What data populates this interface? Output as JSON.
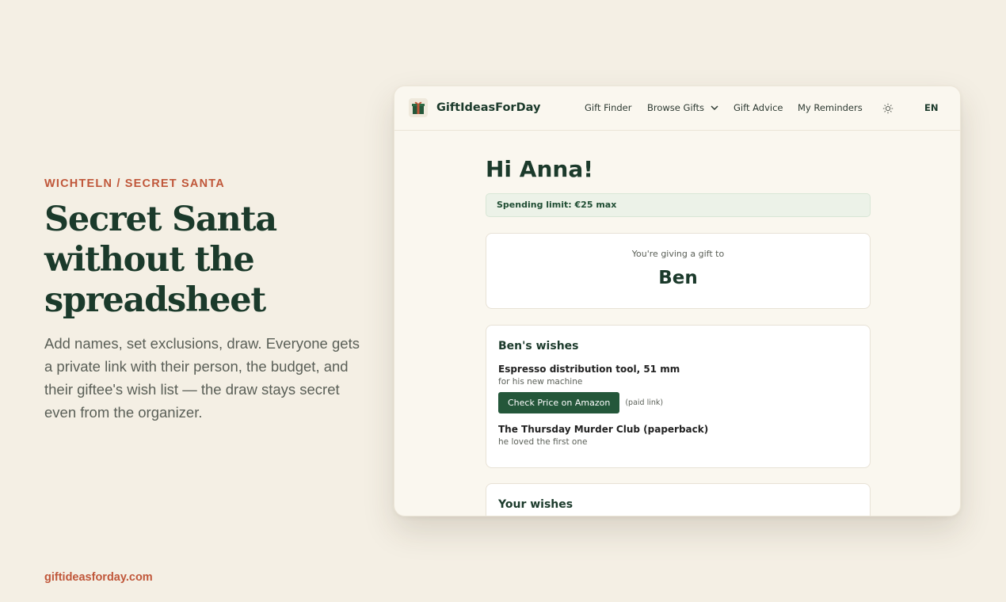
{
  "hero": {
    "eyebrow": "WICHTELN / SECRET SANTA",
    "headline": "Secret Santa\nwithout the\nspreadsheet",
    "lede": "Add names, set exclusions, draw. Everyone gets a private link with their person, the budget, and their giftee's wish list — the draw stays secret even from the organizer.",
    "site_url": "giftideasforday.com"
  },
  "app": {
    "brand": "GiftIdeasForDay",
    "nav": {
      "gift_finder": "Gift Finder",
      "browse_gifts": "Browse Gifts",
      "gift_advice": "Gift Advice",
      "my_reminders": "My Reminders",
      "language": "EN"
    },
    "greeting": "Hi Anna!",
    "spending_limit": "Spending limit: €25 max",
    "giftee": {
      "label": "You're giving a gift to",
      "name": "Ben"
    },
    "wishes": {
      "title": "Ben's wishes",
      "items": [
        {
          "title": "Espresso distribution tool, 51 mm",
          "note": "for his new machine",
          "button": "Check Price on Amazon",
          "paid_note": "(paid link)"
        },
        {
          "title": "The Thursday Murder Club (paperback)",
          "note": "he loved the first one"
        }
      ]
    },
    "your_wishes": {
      "title": "Your wishes"
    }
  },
  "colors": {
    "accent": "#c0573a",
    "primary": "#1b3a2b",
    "button": "#24573a",
    "background": "#f4efe4"
  }
}
